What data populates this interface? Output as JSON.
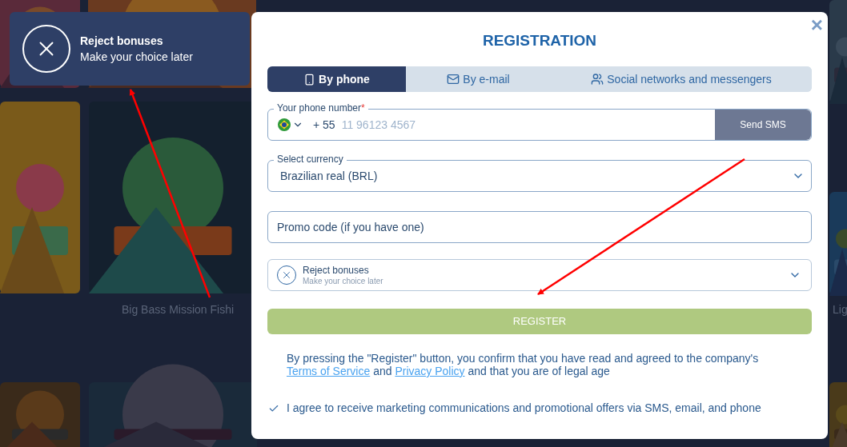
{
  "background": {
    "captions": [
      "Big Bass Mission Fishi",
      "Lig"
    ]
  },
  "bonus_toast": {
    "title": "Reject bonuses",
    "subtitle": "Make your choice later"
  },
  "dialog": {
    "title": "REGISTRATION",
    "close": "×",
    "tabs": [
      {
        "label": "By phone",
        "kind": "phone",
        "selected": true
      },
      {
        "label": "By e-mail",
        "kind": "email",
        "selected": false
      },
      {
        "label": "Social networks and messengers",
        "kind": "social",
        "selected": false
      }
    ],
    "phone": {
      "label": "Your phone number",
      "required_mark": "*",
      "code": "+ 55",
      "placeholder": "11 96123 4567",
      "button": "Send SMS"
    },
    "currency": {
      "label": "Select currency",
      "value": "Brazilian real (BRL)"
    },
    "promo": {
      "placeholder": "Promo code (if you have one)"
    },
    "bonus": {
      "title": "Reject bonuses",
      "subtitle": "Make your choice later"
    },
    "register": {
      "label": "REGISTER",
      "disabled": true
    },
    "legal": "By pressing the \"Register\" button, you confirm that you have read and agreed to the company's ",
    "legal_links": [
      "Terms of Service",
      "Privacy Policy"
    ],
    "legal_and": " and ",
    "legal_end": " and that you are of legal age",
    "marketing": {
      "label": "I agree to receive marketing communications and promotional offers via SMS, email, and phone",
      "checked": true
    }
  }
}
